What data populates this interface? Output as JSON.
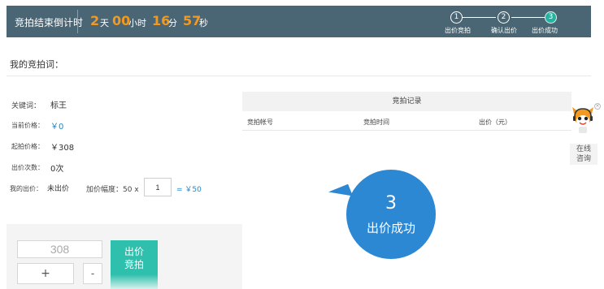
{
  "countdown": {
    "title": "竞拍结束倒计时",
    "days": "2",
    "days_unit": "天",
    "hours": "00",
    "hours_unit": "小时",
    "minutes": "16",
    "minutes_unit": "分",
    "seconds": "57",
    "seconds_unit": "秒"
  },
  "steps": [
    {
      "num": "1",
      "label": "出价竞拍"
    },
    {
      "num": "2",
      "label": "确认出价"
    },
    {
      "num": "3",
      "label": "出价成功",
      "active": true
    }
  ],
  "section_title": "我的竞拍词：",
  "info": {
    "keyword_label": "关键词：",
    "keyword_value": "标王",
    "current_price_label": "当前价格：",
    "current_price_value": "￥0",
    "start_price_label": "起拍价格：",
    "start_price_value": "￥308",
    "bid_count_label": "出价次数：",
    "bid_count_value": "0次",
    "my_bid_label": "我的出价：",
    "my_bid_value": "未出价",
    "increment_label": "加价幅度：50 x",
    "increment_multiplier": "1",
    "increment_total": "= ￥50"
  },
  "records": {
    "title": "竞拍记录",
    "columns": [
      "竞拍帐号",
      "竞拍时间",
      "出价（元）"
    ]
  },
  "bid_panel": {
    "price": "308",
    "plus": "+",
    "minus": "-",
    "bid_button_line1": "出价",
    "bid_button_line2": "竞拍"
  },
  "success_bubble": {
    "number": "3",
    "text": "出价成功"
  },
  "consult": {
    "line1": "在线",
    "line2": "咨询",
    "close": "×"
  },
  "colors": {
    "header_bg": "#4a6675",
    "accent_orange": "#f39a1e",
    "teal": "#2ec0ad",
    "bubble_blue": "#2d88d4",
    "link_blue": "#1f86c8"
  }
}
